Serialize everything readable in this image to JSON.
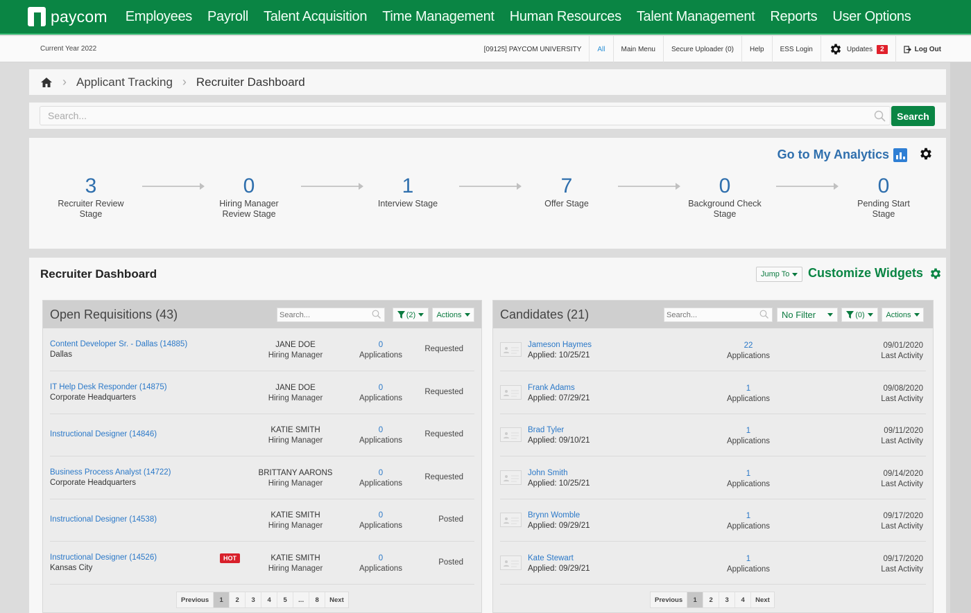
{
  "brand": {
    "name": "paycom",
    "color": "#0a8544"
  },
  "topnav": {
    "items": [
      "Employees",
      "Payroll",
      "Talent Acquisition",
      "Time Management",
      "Human Resources",
      "Talent Management",
      "Reports",
      "User Options"
    ]
  },
  "utilbar": {
    "current_year": "Current Year 2022",
    "company": "[09125] PAYCOM UNIVERSITY",
    "all": "All",
    "main_menu": "Main Menu",
    "secure_uploader": "Secure Uploader (0)",
    "help": "Help",
    "ess_login": "ESS Login",
    "updates": "Updates",
    "updates_count": "2",
    "logout": "Log Out"
  },
  "breadcrumb": {
    "home_icon": "home-icon",
    "items": [
      "Applicant Tracking",
      "Recruiter Dashboard"
    ]
  },
  "search": {
    "placeholder": "Search...",
    "button": "Search"
  },
  "pipeline": {
    "analytics_link": "Go to My Analytics",
    "stages": [
      {
        "count": "3",
        "label": "Recruiter Review Stage"
      },
      {
        "count": "0",
        "label": "Hiring Manager Review Stage"
      },
      {
        "count": "1",
        "label": "Interview Stage"
      },
      {
        "count": "7",
        "label": "Offer Stage"
      },
      {
        "count": "0",
        "label": "Background Check Stage"
      },
      {
        "count": "0",
        "label": "Pending Start Stage"
      }
    ]
  },
  "dashboard": {
    "title": "Recruiter Dashboard",
    "jump_to": "Jump To",
    "customize": "Customize Widgets"
  },
  "requisitions": {
    "title": "Open Requisitions (43)",
    "search_placeholder": "Search...",
    "filter": "(2)",
    "actions": "Actions",
    "rows": [
      {
        "title": "Content Developer Sr. - Dallas (14885)",
        "location": "Dallas",
        "manager": "JANE DOE",
        "role": "Hiring Manager",
        "apps": "0",
        "apps_label": "Applications",
        "status": "Requested",
        "hot": false
      },
      {
        "title": "IT Help Desk Responder (14875)",
        "location": "Corporate Headquarters",
        "manager": "JANE DOE",
        "role": "Hiring Manager",
        "apps": "0",
        "apps_label": "Applications",
        "status": "Requested",
        "hot": false
      },
      {
        "title": "Instructional Designer (14846)",
        "location": "",
        "manager": "KATIE SMITH",
        "role": "Hiring Manager",
        "apps": "0",
        "apps_label": "Applications",
        "status": "Requested",
        "hot": false
      },
      {
        "title": "Business Process Analyst (14722)",
        "location": "Corporate Headquarters",
        "manager": "BRITTANY AARONS",
        "role": "Hiring Manager",
        "apps": "0",
        "apps_label": "Applications",
        "status": "Requested",
        "hot": false
      },
      {
        "title": "Instructional Designer (14538)",
        "location": "",
        "manager": "KATIE SMITH",
        "role": "Hiring Manager",
        "apps": "0",
        "apps_label": "Applications",
        "status": "Posted",
        "hot": false
      },
      {
        "title": "Instructional Designer (14526)",
        "location": "Kansas City",
        "manager": "KATIE SMITH",
        "role": "Hiring Manager",
        "apps": "0",
        "apps_label": "Applications",
        "status": "Posted",
        "hot": true,
        "hot_label": "HOT"
      }
    ],
    "pager": [
      "Previous",
      "1",
      "2",
      "3",
      "4",
      "5",
      "...",
      "8",
      "Next"
    ],
    "pager_active": "1"
  },
  "candidates": {
    "title": "Candidates (21)",
    "search_placeholder": "Search...",
    "no_filter": "No Filter",
    "filter": "(0)",
    "actions": "Actions",
    "rows": [
      {
        "name": "Jameson Haymes",
        "applied": "Applied: 10/25/21",
        "apps": "22",
        "apps_label": "Applications",
        "date": "09/01/2020",
        "date_label": "Last Activity"
      },
      {
        "name": "Frank Adams",
        "applied": "Applied: 07/29/21",
        "apps": "1",
        "apps_label": "Applications",
        "date": "09/08/2020",
        "date_label": "Last Activity"
      },
      {
        "name": "Brad Tyler",
        "applied": "Applied: 09/10/21",
        "apps": "1",
        "apps_label": "Applications",
        "date": "09/11/2020",
        "date_label": "Last Activity"
      },
      {
        "name": "John Smith",
        "applied": "Applied: 10/25/21",
        "apps": "1",
        "apps_label": "Applications",
        "date": "09/14/2020",
        "date_label": "Last Activity"
      },
      {
        "name": "Brynn Womble",
        "applied": "Applied: 09/29/21",
        "apps": "1",
        "apps_label": "Applications",
        "date": "09/17/2020",
        "date_label": "Last Activity"
      },
      {
        "name": "Kate Stewart",
        "applied": "Applied: 09/29/21",
        "apps": "1",
        "apps_label": "Applications",
        "date": "09/17/2020",
        "date_label": "Last Activity"
      }
    ],
    "pager": [
      "Previous",
      "1",
      "2",
      "3",
      "4",
      "Next"
    ],
    "pager_active": "1"
  }
}
